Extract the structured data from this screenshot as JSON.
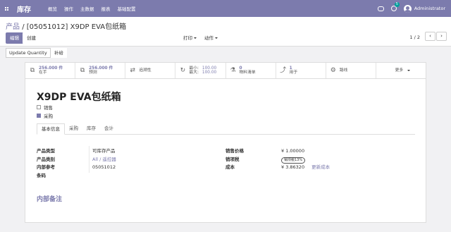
{
  "topbar": {
    "brand": "库存",
    "menu": [
      "概览",
      "操作",
      "主数据",
      "报表",
      "基础配置"
    ],
    "activity_count": "5",
    "user": "Administrator"
  },
  "control": {
    "breadcrumb_parent": "产品",
    "breadcrumb_separator": "/",
    "breadcrumb_current": "[05051012] X9DP EVA包纸箱",
    "edit_label": "编辑",
    "create_label": "创建",
    "print_label": "打印",
    "action_label": "动作",
    "pager": "1 / 2",
    "prev": "‹",
    "next": "›"
  },
  "actions": {
    "update_qty": "Update Quantity",
    "replenish": "补给"
  },
  "stats": {
    "on_hand_num": "256.000 件",
    "on_hand_label": "在手",
    "forecast_num": "256.000 件",
    "forecast_label": "预测",
    "traceability": "追溯性",
    "min_label": "最小:",
    "min_val": "100.00",
    "max_label": "最大:",
    "max_val": "100.00",
    "bom_num": "0",
    "bom_label": "物料清单",
    "used_num": "1",
    "used_label": "用于",
    "routes": "路线",
    "more": "更多"
  },
  "product": {
    "name": "X9DP EVA包纸箱",
    "sale_ok_label": "销售",
    "purchase_ok_label": "采购"
  },
  "tabs": [
    "基本信息",
    "采购",
    "库存",
    "会计"
  ],
  "fields_left": {
    "type_label": "产品类型",
    "type_value": "可库存产品",
    "categ_label": "产品类别",
    "categ_value": "All / 遥控器",
    "ref_label": "内部参考",
    "ref_value": "05051012",
    "barcode_label": "条码"
  },
  "fields_right": {
    "price_label": "销售价格",
    "price_value": "¥ 1.00000",
    "tax_label": "销项税",
    "tax_value": "销项税13%",
    "cost_label": "成本",
    "cost_value": "¥ 3.86320",
    "update_cost": "更新成本"
  },
  "notes_title": "内部备注",
  "colors": {
    "brand": "#7c7bad",
    "badge": "#00a09d"
  },
  "icons": [
    "apps-icon",
    "chat-icon",
    "clock-icon",
    "cubes-icon",
    "arrows-icon",
    "refresh-icon",
    "flask-icon",
    "level-up-icon",
    "cogs-icon"
  ]
}
